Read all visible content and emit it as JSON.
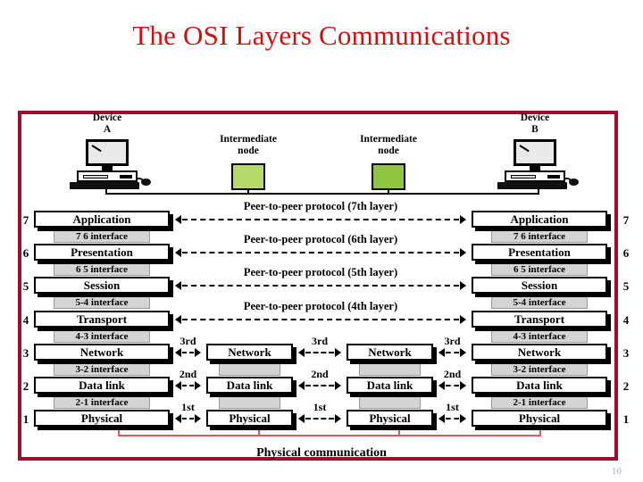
{
  "slide": {
    "title": "The OSI Layers Communications",
    "page_number": "10"
  },
  "colors": {
    "title_red": "#cc1111",
    "frame_maroon": "#9b0e2e",
    "node_green_1": "#b5d96a",
    "node_green_2": "#8ec63f",
    "interface_gray": "#d4d4d4",
    "physical_line_red": "#e2565c"
  },
  "devices": [
    {
      "label_line1": "Device",
      "label_line2": "A",
      "name": "device-a"
    },
    {
      "label_line1": "Device",
      "label_line2": "B",
      "name": "device-b"
    }
  ],
  "intermediate_nodes": [
    {
      "label_line1": "Intermediate",
      "label_line2": "node",
      "color": "#b5d96a"
    },
    {
      "label_line1": "Intermediate",
      "label_line2": "node",
      "color": "#8ec63f"
    }
  ],
  "layer_numbers": [
    "7",
    "6",
    "5",
    "4",
    "3",
    "2",
    "1"
  ],
  "end_stack": {
    "layers": [
      "Application",
      "Presentation",
      "Session",
      "Transport",
      "Network",
      "Data link",
      "Physical"
    ],
    "interfaces": [
      "7  6 interface",
      "6  5 interface",
      "5-4 interface",
      "4-3 interface",
      "3-2 interface",
      "2-1 interface"
    ]
  },
  "intermediate_stack": {
    "layers": [
      "Network",
      "Data link",
      "Physical"
    ]
  },
  "peer_protocol_labels": [
    "Peer-to-peer protocol (7th layer)",
    "Peer-to-peer protocol (6th layer)",
    "Peer-to-peer protocol (5th layer)",
    "Peer-to-peer protocol (4th layer)"
  ],
  "hop_labels": {
    "network": "3rd",
    "datalink": "2nd",
    "physical": "1st"
  },
  "bottom_label": "Physical communication"
}
